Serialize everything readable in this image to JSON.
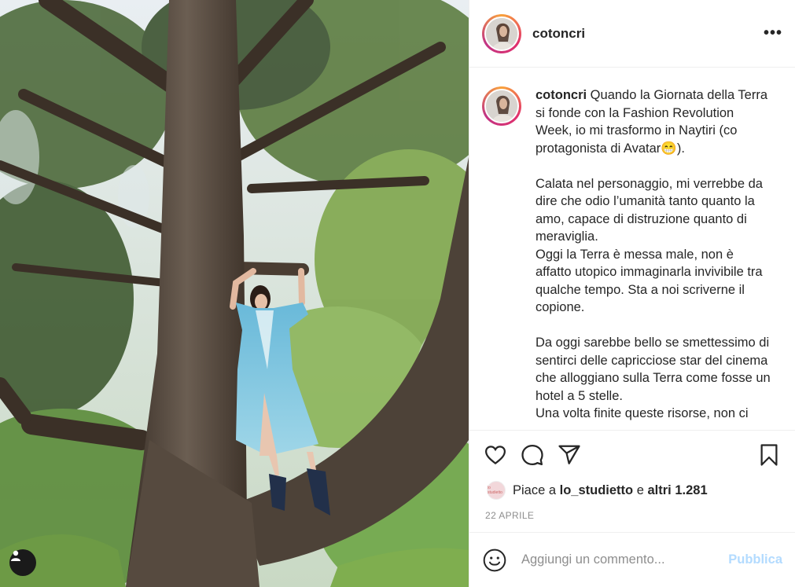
{
  "post": {
    "username": "cotoncri",
    "more_label": "•••",
    "caption": {
      "username": "cotoncri",
      "paragraphs": [
        " Quando la Giornata della Terra si fonde con la Fashion Revolution Week, io mi trasformo in Naytiri (co protagonista di Avatar😁).",
        "Calata nel personaggio, mi verrebbe da dire che odio l’umanità tanto quanto la amo, capace di distruzione quanto di meraviglia.\nOggi la Terra è messa male, non è affatto utopico immaginarla invivibile tra qualche tempo. Sta a noi scriverne il copione.",
        "Da oggi sarebbe bello se smettessimo di sentirci delle capricciose star del cinema che alloggiano sulla Terra come fosse un hotel a 5 stelle.\nUna volta finite queste risorse, non ci"
      ]
    },
    "likes": {
      "prefix": "Piace a ",
      "user": "lo_studietto",
      "middle": " e ",
      "others": "altri 1.281",
      "avatar_text": "lo studietto"
    },
    "date": "22 APRILE",
    "comment_placeholder": "Aggiungi un commento...",
    "publish_label": "Pubblica"
  },
  "icons": {
    "like": "heart-icon",
    "comment": "comment-icon",
    "share": "paper-plane-icon",
    "save": "bookmark-icon",
    "emoji": "smiley-icon",
    "tagged": "user-tag-icon",
    "more": "more-options-icon"
  },
  "colors": {
    "text": "#262626",
    "muted": "#8e8e8e",
    "publish_disabled": "#b3dbff",
    "border": "#efefef"
  }
}
